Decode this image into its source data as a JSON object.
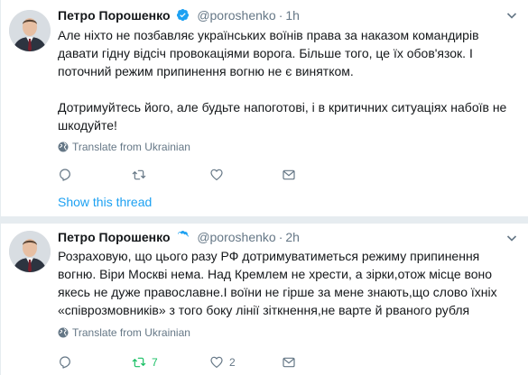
{
  "colors": {
    "accent": "#1da1f2",
    "retweet_active": "#17bf63",
    "muted": "#657786"
  },
  "show_thread": "Show this thread",
  "tweets": [
    {
      "name": "Петро Порошенко",
      "handle": "@poroshenko",
      "separator": "·",
      "time": "1h",
      "paragraphs": [
        "Але ніхто не позбавляє українських воїнів права за наказом командирів давати гідну відсіч провокаціями ворога. Більше того, це їх обов'язок. І поточний режим припинення вогню не є винятком.",
        "Дотримуйтесь його, але будьте напоготові, і в критичних ситуаціях набоїв не шкодуйте!"
      ],
      "translate": "Translate from Ukrainian",
      "retweets": "",
      "likes": ""
    },
    {
      "name": "Петро Порошенко",
      "handle": "@poroshenko",
      "separator": "·",
      "time": "2h",
      "paragraphs": [
        "Розраховую, що цього разу РФ дотримуватиметься режиму припинення вогню. Віри Москві нема. Над Кремлем не хрести, а зірки,отож місце воно якесь не дуже православне.І воїни не гірше за мене знають,що слово їхніх «співрозмовників» з того боку лінії зіткнення,не варте й рваного рубля"
      ],
      "translate": "Translate from Ukrainian",
      "retweets": "7",
      "likes": "2"
    }
  ],
  "icons": [
    "verified-badge-icon",
    "chevron-down-icon",
    "globe-icon",
    "reply-icon",
    "retweet-icon",
    "heart-icon",
    "envelope-icon"
  ]
}
